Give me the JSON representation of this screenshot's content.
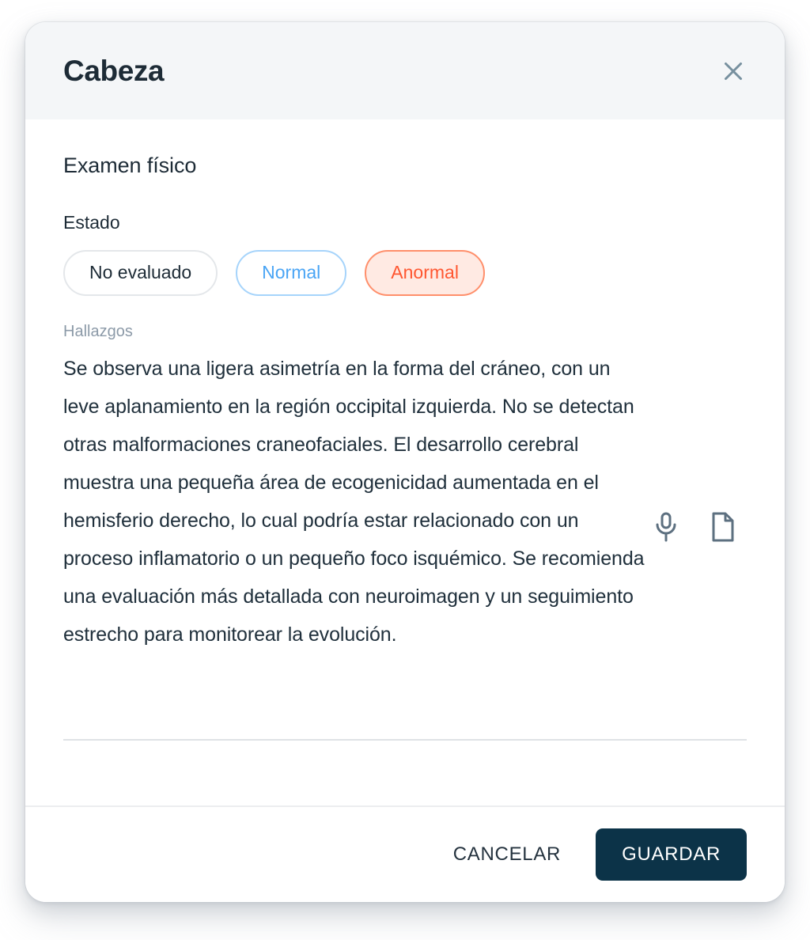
{
  "modal": {
    "title": "Cabeza",
    "close_icon": "close-icon",
    "section_title": "Examen físico",
    "status": {
      "label": "Estado",
      "options": [
        {
          "label": "No evaluado",
          "state": "unevaluated",
          "selected": false
        },
        {
          "label": "Normal",
          "state": "normal",
          "selected": false
        },
        {
          "label": "Anormal",
          "state": "abnormal",
          "selected": true
        }
      ],
      "selected_value": "Anormal"
    },
    "findings": {
      "label": "Hallazgos",
      "value": "Se observa una ligera asimetría en la forma del cráneo, con un leve aplanamiento en la región occipital izquierda. No se detectan otras malformaciones craneofaciales. El desarrollo cerebral muestra una pequeña área de ecogenicidad aumentada en el hemisferio derecho, lo cual podría estar relacionado con un proceso inflamatorio o un pequeño foco isquémico. Se recomienda una evaluación más detallada con neuroimagen y un seguimiento estrecho para monitorear la evolución.",
      "actions": [
        {
          "icon": "microphone-icon",
          "name": "dictate"
        },
        {
          "icon": "document-icon",
          "name": "template"
        }
      ]
    },
    "footer": {
      "cancel_label": "CANCELAR",
      "save_label": "GUARDAR"
    }
  },
  "colors": {
    "header_background": "#F4F6F8",
    "title_text": "#1D2B36",
    "body_text": "#20303C",
    "muted_text": "#8C9AA8",
    "chip_neutral_border": "#E4E7EA",
    "chip_normal_text": "#4AA5F5",
    "chip_normal_border": "#A6D4FB",
    "chip_abnormal_text": "#FF5630",
    "chip_abnormal_border": "#FF8F6B",
    "chip_abnormal_background": "#FFEAE3",
    "primary_button": "#0C3348",
    "icon_gray": "#5D7080"
  }
}
